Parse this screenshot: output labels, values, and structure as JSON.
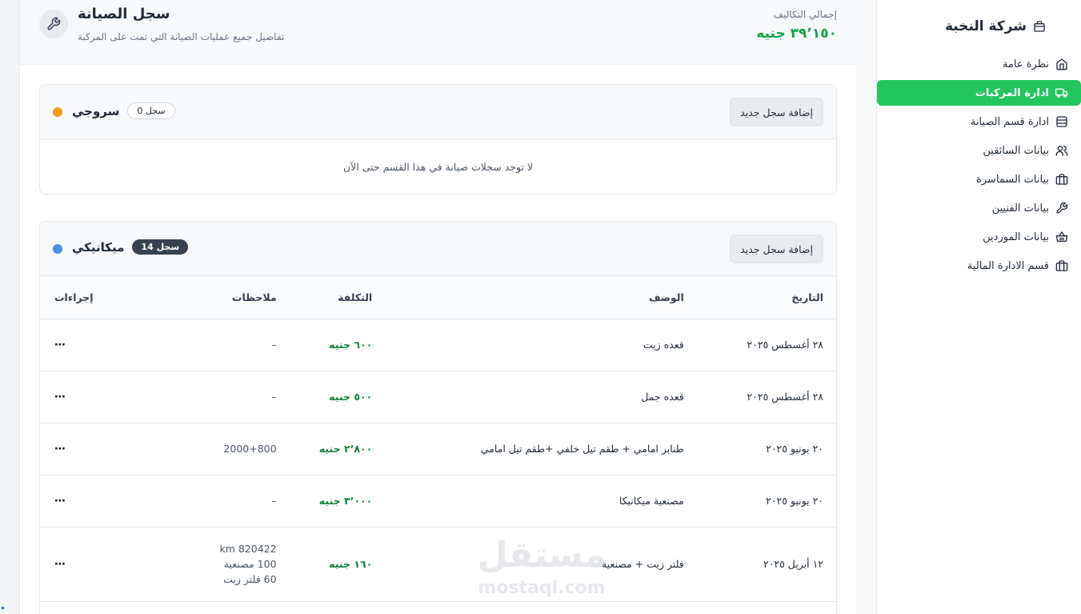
{
  "sidebar": {
    "brand": "شركة النخبة",
    "items": [
      {
        "label": "نظرة عامة",
        "icon": "home-icon",
        "active": false
      },
      {
        "label": "ادارة المركبات",
        "icon": "truck-icon",
        "active": true
      },
      {
        "label": "ادارة قسم الصيانة",
        "icon": "database-icon",
        "active": false
      },
      {
        "label": "بيانات السائقين",
        "icon": "users-icon",
        "active": false
      },
      {
        "label": "بيانات السماسرة",
        "icon": "briefcase-icon",
        "active": false
      },
      {
        "label": "بيانات الفنيين",
        "icon": "wrench-icon",
        "active": false
      },
      {
        "label": "بيانات الموردين",
        "icon": "basket-icon",
        "active": false
      },
      {
        "label": "قسم الادارة المالية",
        "icon": "briefcase-icon",
        "active": false
      }
    ]
  },
  "header": {
    "title": "سجل الصيانة",
    "subtitle": "تفاصيل جميع عمليات الصيانة التي تمت على المركبة",
    "total_label": "إجمالي التكاليف",
    "total_value": "٣٩٬١٥٠ جنيه"
  },
  "sections": [
    {
      "name": "سروجي",
      "count_label": "سجل 0",
      "dot_color": "#f59e0b",
      "add_label": "إضافة سجل جديد",
      "empty_message": "لا توجد سجلات صيانة في هذا القسم حتى الآن"
    },
    {
      "name": "ميكانيكي",
      "count_label": "سجل 14",
      "dot_color": "#4a90e2",
      "add_label": "إضافة سجل جديد",
      "columns": {
        "date": "التاريخ",
        "description": "الوصف",
        "cost": "التكلفة",
        "notes": "ملاحظات",
        "actions": "إجراءات"
      },
      "rows": [
        {
          "date": "٢٨ أغسطس ٢٠٢٥",
          "description": "قعده زيت",
          "cost": "٦٠٠ جنيه",
          "notes": "–",
          "actions": "⋯"
        },
        {
          "date": "٢٨ أغسطس ٢٠٢٥",
          "description": "قعده جمل",
          "cost": "٥٠٠ جنيه",
          "notes": "–",
          "actions": "⋯"
        },
        {
          "date": "٢٠ يونيو ٢٠٢٥",
          "description": "طنابر امامي + طقم تيل خلفي +طقم تيل امامي",
          "cost": "٢٬٨٠٠ جنيه",
          "notes": "2000+800",
          "actions": "⋯"
        },
        {
          "date": "٢٠ يونيو ٢٠٢٥",
          "description": "مصنعية ميكانيكا",
          "cost": "٣٬٠٠٠ جنيه",
          "notes": "–",
          "actions": "⋯"
        },
        {
          "date": "١٢ أبريل ٢٠٢٥",
          "description": "فلتر زيت + مصنعية",
          "cost": "١٦٠ جنيه",
          "notes_lines": [
            "km 820422",
            "100 مصنعية",
            "60 فلتر زيت"
          ],
          "actions": "⋯"
        }
      ]
    }
  ],
  "watermark": {
    "arabic": "مستقل",
    "latin": "mostaql.com"
  },
  "colors": {
    "accent": "#22c55e",
    "money": "#16a34a"
  }
}
